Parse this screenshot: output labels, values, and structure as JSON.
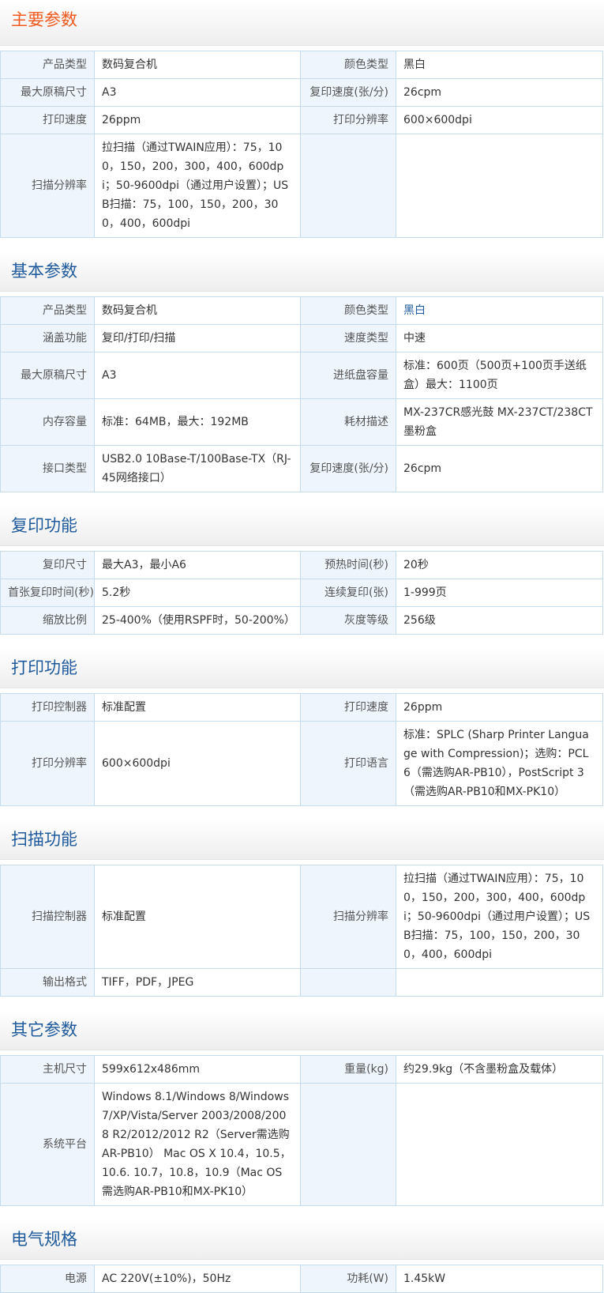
{
  "sections": [
    {
      "title": "主要参数",
      "rows": [
        [
          "产品类型",
          "数码复合机",
          "颜色类型",
          "黑白"
        ],
        [
          "最大原稿尺寸",
          "A3",
          "复印速度(张/分)",
          "26cpm"
        ],
        [
          "打印速度",
          "26ppm",
          "打印分辨率",
          "600×600dpi"
        ],
        [
          "扫描分辨率",
          "拉扫描（通过TWAIN应用）：75，100，150，200，300，400，600dpi；50-9600dpi（通过用户设置）；USB扫描：75，100，150，200，300，400，600dpi",
          "",
          ""
        ]
      ]
    },
    {
      "title": "基本参数",
      "rows": [
        [
          "产品类型",
          "数码复合机",
          "颜色类型",
          "黑白"
        ],
        [
          "涵盖功能",
          "复印/打印/扫描",
          "速度类型",
          "中速"
        ],
        [
          "最大原稿尺寸",
          "A3",
          "进纸盘容量",
          "标准：600页（500页+100页手送纸盒）最大：1100页"
        ],
        [
          "内存容量",
          "标准：64MB，最大：192MB",
          "耗材描述",
          "MX-237CR感光鼓 MX-237CT/238CT墨粉盒"
        ],
        [
          "接口类型",
          "USB2.0 10Base-T/100Base-TX（RJ-45网络接口）",
          "复印速度(张/分)",
          "26cpm"
        ]
      ]
    },
    {
      "title": "复印功能",
      "rows": [
        [
          "复印尺寸",
          "最大A3，最小A6",
          "预热时间(秒)",
          "20秒"
        ],
        [
          "首张复印时间(秒)",
          "5.2秒",
          "连续复印(张)",
          "1-999页"
        ],
        [
          "缩放比例",
          "25-400%（使用RSPF时，50-200%）",
          "灰度等级",
          "256级"
        ]
      ]
    },
    {
      "title": "打印功能",
      "rows": [
        [
          "打印控制器",
          "标准配置",
          "打印速度",
          "26ppm"
        ],
        [
          "打印分辨率",
          "600×600dpi",
          "打印语言",
          "标准：SPLC (Sharp Printer Language with Compression)；选购：PCL 6（需选购AR-PB10），PostScript 3（需选购AR-PB10和MX-PK10）"
        ]
      ]
    },
    {
      "title": "扫描功能",
      "rows": [
        [
          "扫描控制器",
          "标准配置",
          "扫描分辨率",
          "拉扫描（通过TWAIN应用）：75，100，150，200，300，400，600dpi；50-9600dpi（通过用户设置）；USB扫描：75，100，150，200，300，400，600dpi"
        ],
        [
          "输出格式",
          "TIFF，PDF，JPEG",
          "",
          ""
        ]
      ]
    },
    {
      "title": "其它参数",
      "rows": [
        [
          "主机尺寸",
          "599x612x486mm",
          "重量(kg)",
          "约29.9kg（不含墨粉盒及载体）"
        ],
        [
          "系统平台",
          "Windows 8.1/Windows 8/Windows 7/XP/Vista/Server 2003/2008/2008 R2/2012/2012 R2（Server需选购AR-PB10） Mac OS X 10.4，10.5，10.6. 10.7，10.8，10.9（Mac OS需选购AR-PB10和MX-PK10）",
          "",
          ""
        ]
      ]
    },
    {
      "title": "电气规格",
      "rows": [
        [
          "电源",
          "AC 220V(±10%)，50Hz",
          "功耗(W)",
          "1.45kW"
        ]
      ]
    }
  ],
  "colors": {
    "first_title": "#f05a1e",
    "section_title": "#1e5a9c",
    "label_bg": "#eef5fd",
    "border": "#c5dbf0"
  }
}
